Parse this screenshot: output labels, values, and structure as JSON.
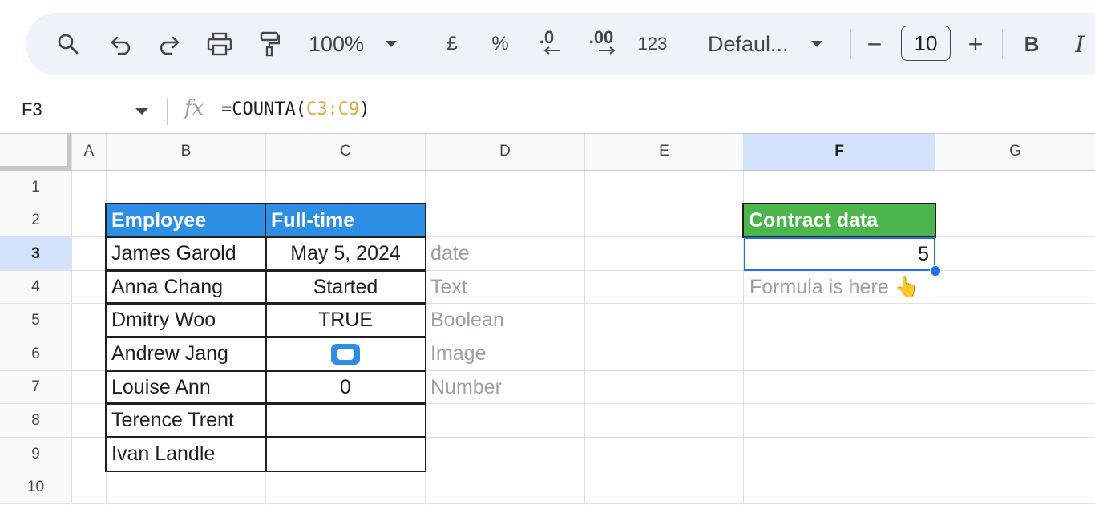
{
  "toolbar": {
    "zoom": "100%",
    "currency": "£",
    "percent": "%",
    "decrease_decimal": ".0",
    "increase_decimal": ".00",
    "format_number": "123",
    "font": "Defaul...",
    "font_size": "10",
    "minus": "−",
    "plus": "+",
    "bold": "B",
    "italic": "I"
  },
  "formula_bar": {
    "name_box": "F3",
    "fx": "fx",
    "formula_prefix": "=COUNTA(",
    "formula_range": "C3:C9",
    "formula_suffix": ")"
  },
  "columns": [
    "A",
    "B",
    "C",
    "D",
    "E",
    "F",
    "G"
  ],
  "rows": [
    "1",
    "2",
    "3",
    "4",
    "5",
    "6",
    "7",
    "8",
    "9",
    "10"
  ],
  "selected_cell": "F3",
  "cells": {
    "B2": "Employee",
    "C2": "Full-time",
    "B3": "James Garold",
    "C3": "May 5, 2024",
    "D3": "date",
    "B4": "Anna Chang",
    "C4": "Started",
    "D4": "Text",
    "B5": "Dmitry Woo",
    "C5": "TRUE",
    "D5": "Boolean",
    "B6": "Andrew Jang",
    "D6": "Image",
    "B7": "Louise Ann",
    "C7": "0",
    "D7": "Number",
    "B8": "Terence Trent",
    "B9": "Ivan Landle",
    "F2": "Contract data",
    "F3": "5",
    "F4": "Formula is here 👆"
  },
  "colors": {
    "employee_header": "#2c8fe3",
    "contract_header": "#4bb64c",
    "selection": "#1a73e8",
    "formula_range": "#e8a33a"
  },
  "icons": [
    "search-icon",
    "undo-icon",
    "redo-icon",
    "print-icon",
    "paint-format-icon",
    "chevron-down-icon",
    "image-in-cell-icon"
  ]
}
